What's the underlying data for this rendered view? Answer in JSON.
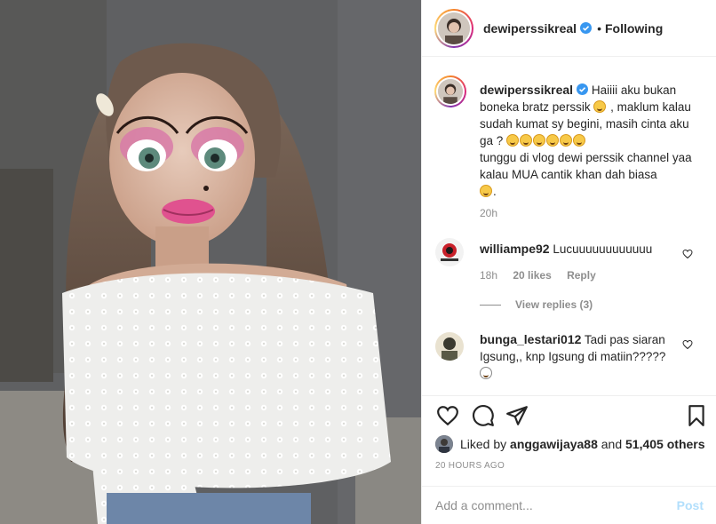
{
  "header": {
    "username": "dewiperssikreal",
    "separator": "•",
    "follow_status": "Following"
  },
  "caption": {
    "username": "dewiperssikreal",
    "line1": "Haiiii aku bukan boneka bratz perssik",
    "line1b": ", maklum kalau sudah kumat sy begini, masih cinta aku ga ?",
    "line2": "tunggu di vlog dewi perssik channel yaa kalau MUA cantik khan dah biasa",
    "line2_end": ".",
    "time": "20h"
  },
  "comments": [
    {
      "username": "williampe92",
      "text": "Lucuuuuuuuuuuuu",
      "time": "18h",
      "likes": "20 likes",
      "reply_label": "Reply",
      "view_replies": "View replies (3)"
    },
    {
      "username": "bunga_lestari012",
      "text": "Tadi pas siaran Igsung,, knp Igsung di matiin?????"
    }
  ],
  "likes": {
    "prefix": "Liked by",
    "user": "anggawijaya88",
    "conj": "and",
    "others": "51,405 others"
  },
  "posted_time": "20 HOURS AGO",
  "comment_box": {
    "placeholder": "Add a comment...",
    "post_label": "Post"
  },
  "colors": {
    "verified": "#3897f0",
    "muted": "#8e8e8e",
    "post_button_disabled": "#b2dffc"
  },
  "icons": [
    "verified-badge-icon",
    "heart-icon",
    "comment-icon",
    "share-icon",
    "bookmark-icon"
  ]
}
